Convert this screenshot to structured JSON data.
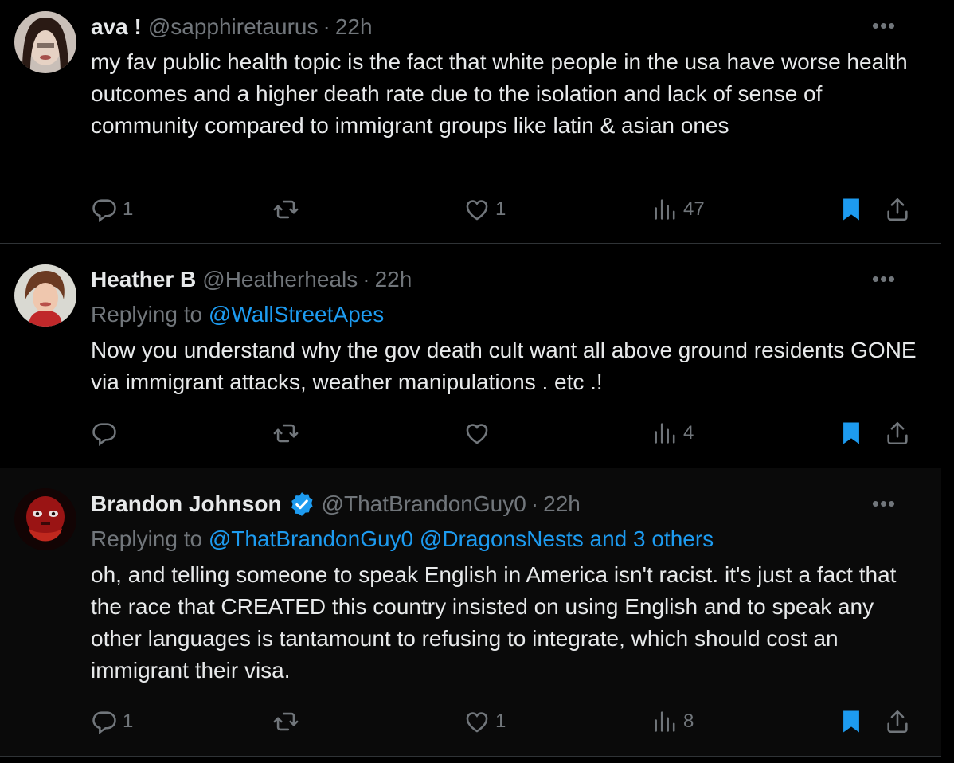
{
  "colors": {
    "background": "#000000",
    "text": "#e7e9ea",
    "muted": "#71767b",
    "link": "#1d9bf0",
    "bookmark_active": "#1d9bf0",
    "divider": "#2f3336"
  },
  "icons": {
    "reply": "speech-bubble",
    "retweet": "retweet-arrows",
    "like": "heart",
    "views": "bar-chart",
    "bookmark": "bookmark-filled",
    "share": "upload-arrow",
    "more": "ellipsis",
    "verified": "blue-check-badge"
  },
  "tweets": [
    {
      "name": "ava !",
      "handle": "@sapphiretaurus",
      "separator": "·",
      "time": "22h",
      "more": "•••",
      "replying_prefix": "",
      "replying_to": "",
      "text": "my fav public health topic is the fact that white people in the usa have worse health outcomes and a higher death rate due to the isolation and lack of sense of community compared to immigrant groups like latin & asian ones",
      "replies": "1",
      "retweets": "",
      "likes": "1",
      "views": "47"
    },
    {
      "name": "Heather B",
      "handle": "@Heatherheals",
      "separator": "·",
      "time": "22h",
      "more": "•••",
      "replying_prefix": "Replying to",
      "replying_to": "@WallStreetApes",
      "text": "Now you understand why  the gov death cult want all above ground residents  GONE  via immigrant attacks, weather  manipulations . etc .!",
      "replies": "",
      "retweets": "",
      "likes": "",
      "views": "4"
    },
    {
      "name": "Brandon Johnson",
      "verified": true,
      "handle": "@ThatBrandonGuy0",
      "separator": "·",
      "time": "22h",
      "more": "•••",
      "replying_prefix": "Replying to",
      "replying_to": "@ThatBrandonGuy0 @DragonsNests and 3 others",
      "text": "oh, and telling someone to speak English in America isn't racist. it's just a fact that the race that CREATED this country insisted on using English and to speak any other languages is tantamount to refusing to integrate, which should cost an immigrant their visa.",
      "replies": "1",
      "retweets": "",
      "likes": "1",
      "views": "8"
    }
  ]
}
